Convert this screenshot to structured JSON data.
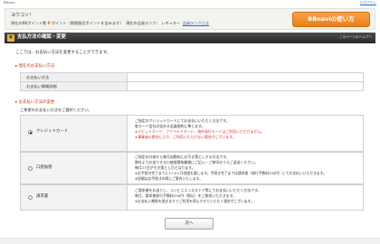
{
  "top": {
    "left_text": "BBnavi",
    "right_link": "ログアウト"
  },
  "info": {
    "greeting": "ヨウコソ！",
    "points_prefix": "現在のBBポイント数",
    "points_value": "0",
    "points_suffix": "ポイント（期限間近ポイントを含みます）",
    "rank_label": "現在の会員ランク：",
    "rank_value": "レギュラー",
    "rank_link": "会員ランクとは",
    "bb_button": "BBnaviの使い方"
  },
  "title": {
    "text": "支払方法の確認・変更",
    "help": "このページのヘルプへ"
  },
  "intro": "ここでは、お支払い方法を変更することができます。",
  "current": {
    "section": "現在のお支払い方法",
    "rows": [
      {
        "label": "お支払い方法",
        "value": ""
      },
      {
        "label": "お支払い情報詳細",
        "value": ""
      }
    ]
  },
  "change": {
    "section": "お支払い方法の変更",
    "intro": "ご希望のお支払い方法をご選択ください。",
    "options": [
      {
        "label": "クレジットカード",
        "selected": true,
        "desc": [
          "ご指定のクレジットカードにてお支払いいただく方法です。",
          "各カード会社の定める会員規約に準じます。",
          "※デビットカード、プリペイドカード、海外発行カードはご利用いただけません。",
          "※事業者の都合により、ご利用いただけない場合がございます。"
        ]
      },
      {
        "label": "口座振替",
        "selected": false,
        "desc": [
          "ご指定の口座から毎月自動的にお引き落としする方法です。",
          "弊社よりお送りする口座振替依頼書にご記入・ご捺印のうえご返送ください。",
          "毎月27日が引き落とし日となります。",
          "※お手続き完了までに1〜2ヶ月程度を要します。手続き完了までは請求書（発行手数料330円）にてお支払いいただきます。",
          "※詳細はお手続きの際にご案内いたします。"
        ]
      },
      {
        "label": "請求書",
        "selected": false,
        "desc": [
          "ご請求書をお送りし、コンビニエンスストア等にてお支払いいただく方法です。",
          "毎月、請求書発行手数料330円（税込）をご負担いただきます。",
          "※お支払い期限を過ぎますとご利用を停止させていただく場合がございます。"
        ]
      }
    ]
  },
  "next_button": "次へ"
}
